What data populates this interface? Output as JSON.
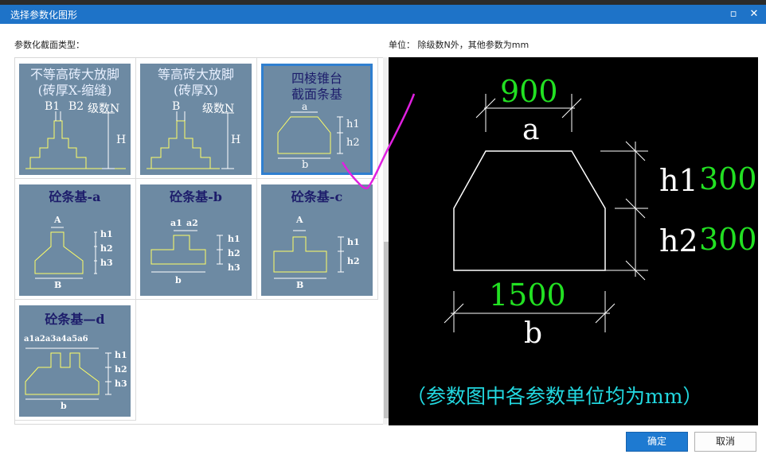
{
  "window": {
    "title": "选择参数化图形",
    "min_glyph": "▫",
    "close_glyph": "✕"
  },
  "left_label": "参数化截面类型：",
  "unit_label": "单位： 除级数N外，其他参数为mm",
  "thumbnails": [
    {
      "title_line1": "不等高砖大放脚",
      "title_line2": "(砖厚X-缩缝)",
      "labels": {
        "b1": "B1",
        "b2": "B2",
        "n": "级数N",
        "h": "H"
      }
    },
    {
      "title_line1": "等高砖大放脚",
      "title_line2": "(砖厚X)",
      "labels": {
        "b": "B",
        "n": "级数N",
        "h": "H"
      }
    },
    {
      "title_line1": "四棱锥台",
      "title_line2": "截面条基",
      "labels": {
        "a": "a",
        "h1": "h1",
        "h2": "h2",
        "b": "b"
      }
    },
    {
      "title": "砼条基-a",
      "labels": {
        "a": "A",
        "h1": "h1",
        "h2": "h2",
        "h3": "h3",
        "b": "B"
      }
    },
    {
      "title": "砼条基-b",
      "labels": {
        "a1": "a1",
        "a2": "a2",
        "h1": "h1",
        "h2": "h2",
        "h3": "h3",
        "b": "b"
      }
    },
    {
      "title": "砼条基-c",
      "labels": {
        "a": "A",
        "h1": "h1",
        "h2": "h2",
        "b": "B"
      }
    },
    {
      "title": "砼条基—d",
      "labels": {
        "a": "a1a2a3a4a5a6",
        "h1": "h1",
        "h2": "h2",
        "h3": "h3",
        "b": "b"
      }
    }
  ],
  "preview": {
    "a_value": "900",
    "a_label": "a",
    "h1_label": "h1",
    "h1_value": "300",
    "h2_label": "h2",
    "h2_value": "300",
    "b_value": "1500",
    "b_label": "b",
    "note": "（参数图中各参数单位均为mm）"
  },
  "buttons": {
    "ok": "确定",
    "cancel": "取消"
  },
  "colors": {
    "accent": "#1e73c8",
    "thumb_bg": "#6d8aa3",
    "shape_line": "#ffff66",
    "dim_green": "#22e022",
    "note_cyan": "#22d8e0",
    "annotation": "#e020e0"
  }
}
